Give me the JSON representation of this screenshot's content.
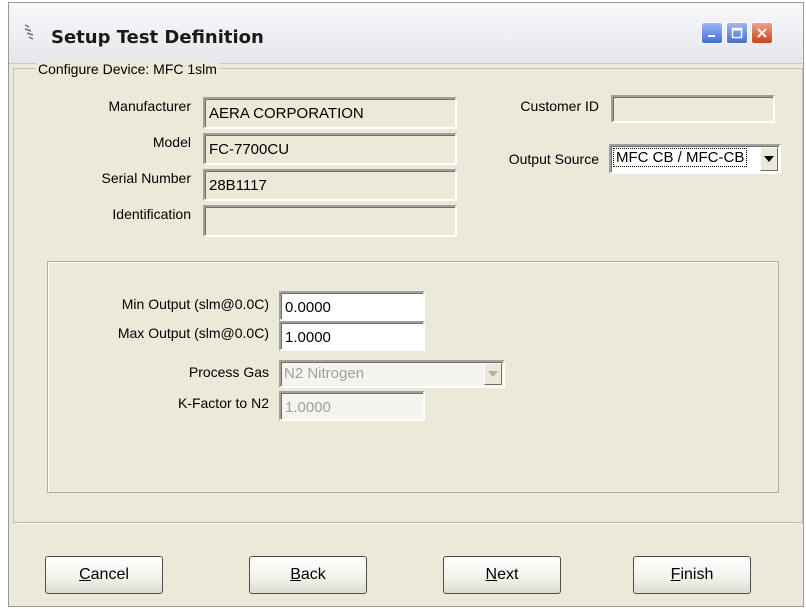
{
  "window": {
    "title": "Setup Test Definition"
  },
  "group": {
    "label": "Configure Device: MFC 1slm"
  },
  "device": {
    "manufacturer_label": "Manufacturer",
    "manufacturer_value": "AERA CORPORATION",
    "model_label": "Model",
    "model_value": "FC-7700CU",
    "serial_label": "Serial Number",
    "serial_value": "28B1117",
    "identification_label": "Identification",
    "identification_value": "",
    "customer_id_label": "Customer ID",
    "customer_id_value": "",
    "output_source_label": "Output Source",
    "output_source_value": "MFC CB / MFC-CB"
  },
  "config": {
    "min_output_label": "Min Output (slm@0.0C)",
    "min_output_value": "0.0000",
    "max_output_label": "Max Output (slm@0.0C)",
    "max_output_value": "1.0000",
    "process_gas_label": "Process Gas",
    "process_gas_value": "N2 Nitrogen",
    "kfactor_label": "K-Factor to N2",
    "kfactor_value": "1.0000"
  },
  "buttons": {
    "cancel_first": "C",
    "cancel_rest": "ancel",
    "back_first": "B",
    "back_rest": "ack",
    "next_first": "N",
    "next_rest": "ext",
    "finish_first": "F",
    "finish_rest": "inish"
  },
  "colors": {
    "dialog_bg": "#ece9d8",
    "close_button": "#d04118",
    "title_buttons": "#3e6ee3"
  }
}
